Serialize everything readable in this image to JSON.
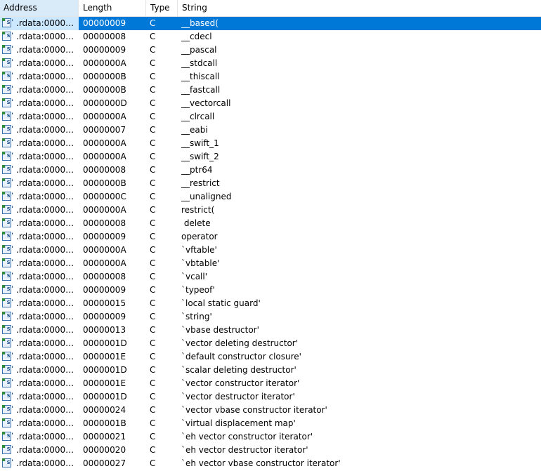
{
  "columns": [
    {
      "label": "Address"
    },
    {
      "label": "Length"
    },
    {
      "label": "Type"
    },
    {
      "label": "String"
    }
  ],
  "icon": {
    "name": "string-item-icon",
    "glyph": "'s'"
  },
  "selected_row": 0,
  "rows": [
    {
      "address": ".rdata:000000...",
      "length": "00000009",
      "type": "C",
      "string": "__based("
    },
    {
      "address": ".rdata:000000...",
      "length": "00000008",
      "type": "C",
      "string": "__cdecl"
    },
    {
      "address": ".rdata:000000...",
      "length": "00000009",
      "type": "C",
      "string": "__pascal"
    },
    {
      "address": ".rdata:000000...",
      "length": "0000000A",
      "type": "C",
      "string": "__stdcall"
    },
    {
      "address": ".rdata:000000...",
      "length": "0000000B",
      "type": "C",
      "string": "__thiscall"
    },
    {
      "address": ".rdata:000000...",
      "length": "0000000B",
      "type": "C",
      "string": "__fastcall"
    },
    {
      "address": ".rdata:000000...",
      "length": "0000000D",
      "type": "C",
      "string": "__vectorcall"
    },
    {
      "address": ".rdata:000000...",
      "length": "0000000A",
      "type": "C",
      "string": "__clrcall"
    },
    {
      "address": ".rdata:000000...",
      "length": "00000007",
      "type": "C",
      "string": "__eabi"
    },
    {
      "address": ".rdata:000000...",
      "length": "0000000A",
      "type": "C",
      "string": "__swift_1"
    },
    {
      "address": ".rdata:000000...",
      "length": "0000000A",
      "type": "C",
      "string": "__swift_2"
    },
    {
      "address": ".rdata:000000...",
      "length": "00000008",
      "type": "C",
      "string": "__ptr64"
    },
    {
      "address": ".rdata:000000...",
      "length": "0000000B",
      "type": "C",
      "string": "__restrict"
    },
    {
      "address": ".rdata:000000...",
      "length": "0000000C",
      "type": "C",
      "string": "__unaligned"
    },
    {
      "address": ".rdata:000000...",
      "length": "0000000A",
      "type": "C",
      "string": "restrict("
    },
    {
      "address": ".rdata:000000...",
      "length": "00000008",
      "type": "C",
      "string": " delete"
    },
    {
      "address": ".rdata:000000...",
      "length": "00000009",
      "type": "C",
      "string": "operator"
    },
    {
      "address": ".rdata:000000...",
      "length": "0000000A",
      "type": "C",
      "string": "`vftable'"
    },
    {
      "address": ".rdata:000000...",
      "length": "0000000A",
      "type": "C",
      "string": "`vbtable'"
    },
    {
      "address": ".rdata:000000...",
      "length": "00000008",
      "type": "C",
      "string": "`vcall'"
    },
    {
      "address": ".rdata:000000...",
      "length": "00000009",
      "type": "C",
      "string": "`typeof'"
    },
    {
      "address": ".rdata:000000...",
      "length": "00000015",
      "type": "C",
      "string": "`local static guard'"
    },
    {
      "address": ".rdata:000000...",
      "length": "00000009",
      "type": "C",
      "string": "`string'"
    },
    {
      "address": ".rdata:000000...",
      "length": "00000013",
      "type": "C",
      "string": "`vbase destructor'"
    },
    {
      "address": ".rdata:000000...",
      "length": "0000001D",
      "type": "C",
      "string": "`vector deleting destructor'"
    },
    {
      "address": ".rdata:000000...",
      "length": "0000001E",
      "type": "C",
      "string": "`default constructor closure'"
    },
    {
      "address": ".rdata:000000...",
      "length": "0000001D",
      "type": "C",
      "string": "`scalar deleting destructor'"
    },
    {
      "address": ".rdata:000000...",
      "length": "0000001E",
      "type": "C",
      "string": "`vector constructor iterator'"
    },
    {
      "address": ".rdata:000000...",
      "length": "0000001D",
      "type": "C",
      "string": "`vector destructor iterator'"
    },
    {
      "address": ".rdata:000000...",
      "length": "00000024",
      "type": "C",
      "string": "`vector vbase constructor iterator'"
    },
    {
      "address": ".rdata:000000...",
      "length": "0000001B",
      "type": "C",
      "string": "`virtual displacement map'"
    },
    {
      "address": ".rdata:000000...",
      "length": "00000021",
      "type": "C",
      "string": "`eh vector constructor iterator'"
    },
    {
      "address": ".rdata:000000...",
      "length": "00000020",
      "type": "C",
      "string": "`eh vector destructor iterator'"
    },
    {
      "address": ".rdata:000000...",
      "length": "00000027",
      "type": "C",
      "string": "`eh vector vbase constructor iterator'"
    }
  ],
  "colors": {
    "selection": "#0078d7",
    "selection_cell": "#cce8ff",
    "header_active": "#d9ebf9"
  }
}
